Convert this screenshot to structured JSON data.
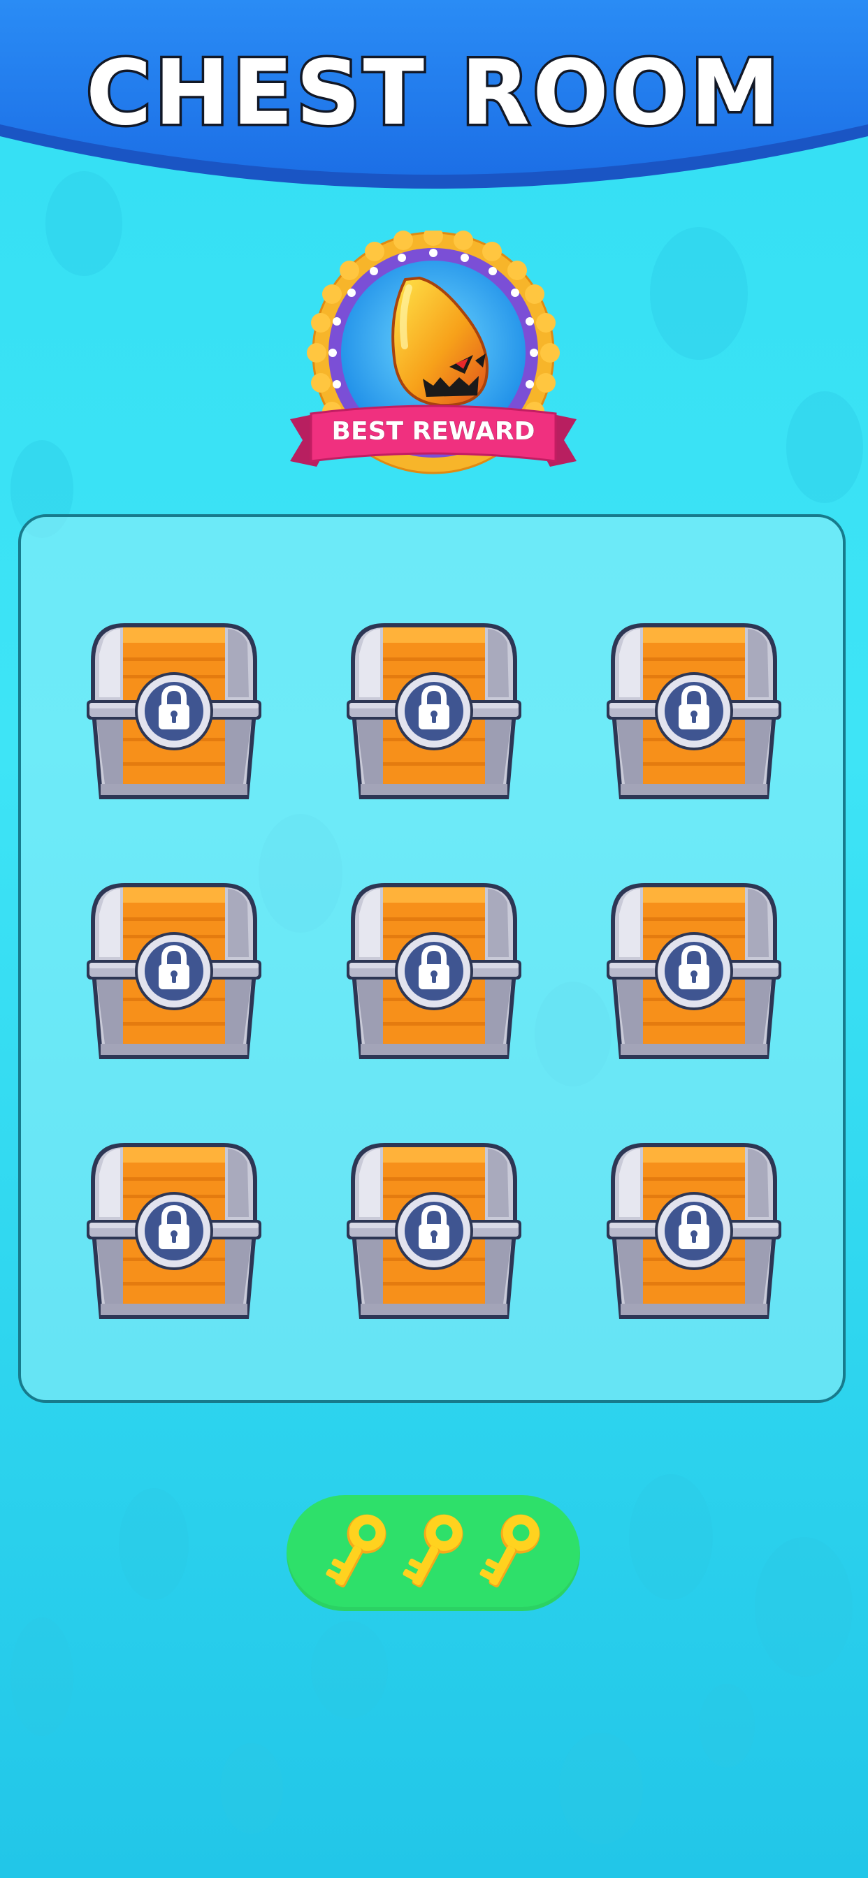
{
  "header": {
    "title": "CHEST ROOM"
  },
  "reward": {
    "label": "BEST REWARD",
    "item_icon": "pumpkin-creature-icon"
  },
  "chests": [
    {
      "state": "locked",
      "icon": "lock-icon"
    },
    {
      "state": "locked",
      "icon": "lock-icon"
    },
    {
      "state": "locked",
      "icon": "lock-icon"
    },
    {
      "state": "locked",
      "icon": "lock-icon"
    },
    {
      "state": "locked",
      "icon": "lock-icon"
    },
    {
      "state": "locked",
      "icon": "lock-icon"
    },
    {
      "state": "locked",
      "icon": "lock-icon"
    },
    {
      "state": "locked",
      "icon": "lock-icon"
    },
    {
      "state": "locked",
      "icon": "lock-icon"
    }
  ],
  "keys": {
    "count": 3,
    "icon": "key-icon"
  },
  "colors": {
    "background": "#34dff3",
    "header": "#1f7ef0",
    "ribbon": "#f0307f",
    "chest_body": "#f7901a",
    "chest_metal": "#c9cad8",
    "lock_badge": "#3f5591",
    "keys_bar": "#2ee06a",
    "key": "#ffd21f"
  }
}
